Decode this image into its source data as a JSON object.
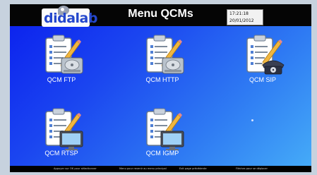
{
  "header": {
    "title": "Menu QCMs",
    "logo_text": "didalab",
    "time": "17:21:18",
    "date": "20/01/2012"
  },
  "menu": {
    "items": [
      {
        "label": "QCM FTP",
        "icon": "clipboard-hard-drive-icon"
      },
      {
        "label": "QCM HTTP",
        "icon": "clipboard-hard-drive-icon"
      },
      {
        "label": "QCM SIP",
        "icon": "clipboard-telephone-icon"
      },
      {
        "label": "QCM RTSP",
        "icon": "clipboard-monitor-icon"
      },
      {
        "label": "QCM IGMP",
        "icon": "clipboard-monitor-icon"
      }
    ]
  },
  "footer": {
    "hints": [
      "Appuyer sur OK pour sélectionner",
      "Menu pour revenir au menu principal",
      "Exit page précédente",
      "Flèches pour se déplacer"
    ]
  },
  "colors": {
    "background_start": "#0a1eee",
    "background_end": "#46adf8",
    "header_bar": "#050505",
    "logo_text": "#2447cc"
  }
}
